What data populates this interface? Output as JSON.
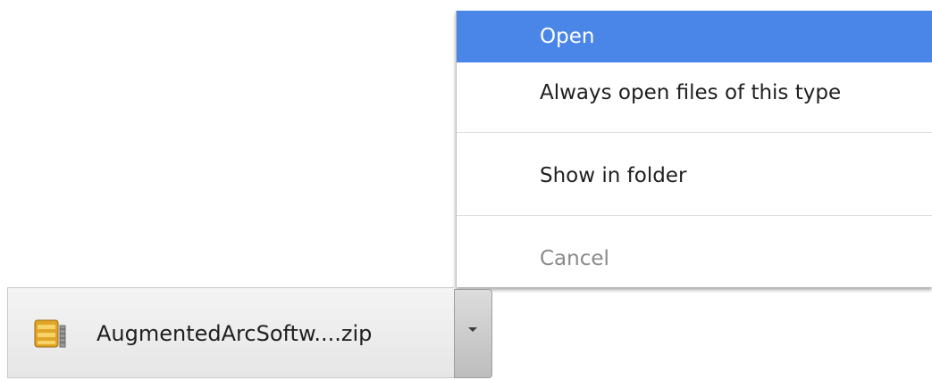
{
  "context_menu": {
    "items": [
      {
        "label": "Open",
        "state": "highlighted"
      },
      {
        "label": "Always open files of this type",
        "state": "normal"
      },
      {
        "label": "Show in folder",
        "state": "normal"
      },
      {
        "label": "Cancel",
        "state": "disabled"
      }
    ]
  },
  "download": {
    "file_name": "AugmentedArcSoftw....zip",
    "icon": "zip-archive-icon",
    "dropdown_icon": "chevron-down-icon"
  },
  "colors": {
    "highlight": "#4a86e8",
    "disabled_text": "#8a8a8a"
  }
}
